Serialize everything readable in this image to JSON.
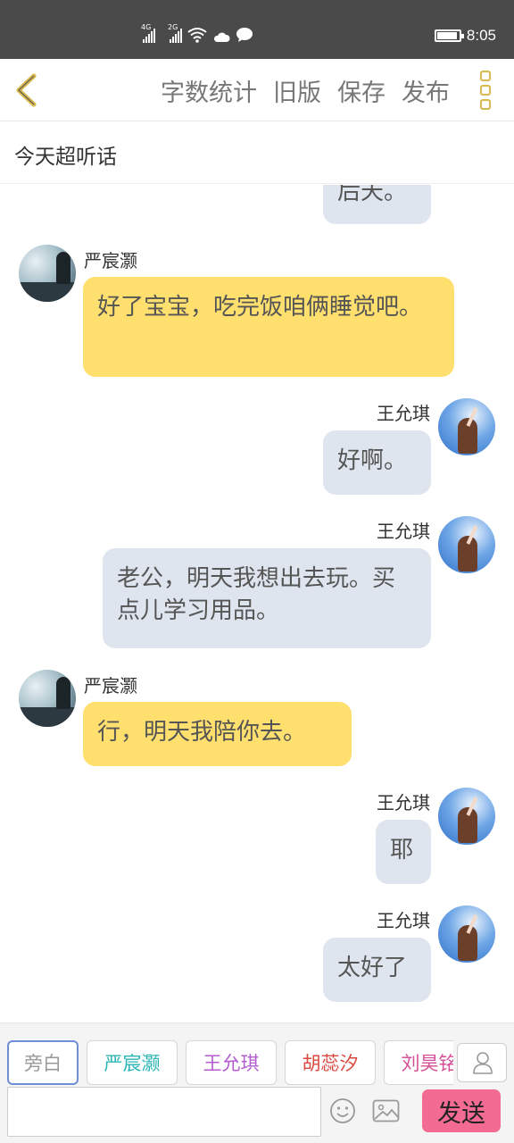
{
  "status_bar": {
    "signal1_label": "4G",
    "signal2_label": "2G",
    "time": "8:05"
  },
  "header": {
    "actions": [
      "字数统计",
      "旧版",
      "保存",
      "发布"
    ]
  },
  "chat_title": "今天超听话",
  "messages": [
    {
      "side": "right",
      "speaker": "",
      "text": "后天。",
      "color": "#dfe5ee"
    },
    {
      "side": "left",
      "speaker": "严宸灏",
      "text": "好了宝宝，吃完饭咱俩睡觉吧。",
      "color": "#ffdf6e"
    },
    {
      "side": "right",
      "speaker": "王允琪",
      "text": "好啊。",
      "color": "#dfe5ee"
    },
    {
      "side": "right",
      "speaker": "王允琪",
      "text": "老公，明天我想出去玩。买点儿学习用品。",
      "color": "#dfe5ee"
    },
    {
      "side": "left",
      "speaker": "严宸灏",
      "text": "行，明天我陪你去。",
      "color": "#ffdf6e"
    },
    {
      "side": "right",
      "speaker": "王允琪",
      "text": "耶",
      "color": "#dfe5ee"
    },
    {
      "side": "right",
      "speaker": "王允琪",
      "text": "太好了",
      "color": "#dfe5ee"
    }
  ],
  "roles": [
    {
      "label": "旁白",
      "color": "#999999",
      "active": true
    },
    {
      "label": "严宸灏",
      "color": "#2cb5b5",
      "active": false
    },
    {
      "label": "王允琪",
      "color": "#b35bcf",
      "active": false
    },
    {
      "label": "胡蕊汐",
      "color": "#d84a3f",
      "active": false
    },
    {
      "label": "刘昊铭",
      "color": "#d64f96",
      "active": false
    }
  ],
  "input": {
    "placeholder": ""
  },
  "send_label": "发送",
  "colors": {
    "accent_yellow": "#d8b84c",
    "send_pink": "#f36b93"
  }
}
